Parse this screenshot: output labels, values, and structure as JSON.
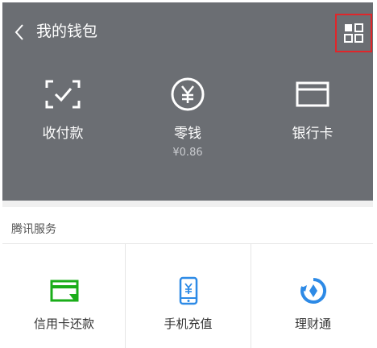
{
  "header": {
    "title": "我的钱包",
    "items": [
      {
        "label": "收付款",
        "icon": "scan-pay-icon"
      },
      {
        "label": "零钱",
        "sub": "¥0.86",
        "icon": "yuan-coin-icon"
      },
      {
        "label": "银行卡",
        "icon": "bank-card-icon"
      }
    ]
  },
  "services": {
    "section_title": "腾讯服务",
    "items": [
      {
        "label": "信用卡还款",
        "icon": "credit-card-repay-icon"
      },
      {
        "label": "手机充值",
        "icon": "phone-recharge-icon"
      },
      {
        "label": "理财通",
        "icon": "wealth-icon"
      }
    ]
  },
  "colors": {
    "header_bg": "#6b6e73",
    "accent_green": "#1aad19",
    "accent_blue": "#2d8ae6",
    "highlight_red": "#e0262a"
  }
}
